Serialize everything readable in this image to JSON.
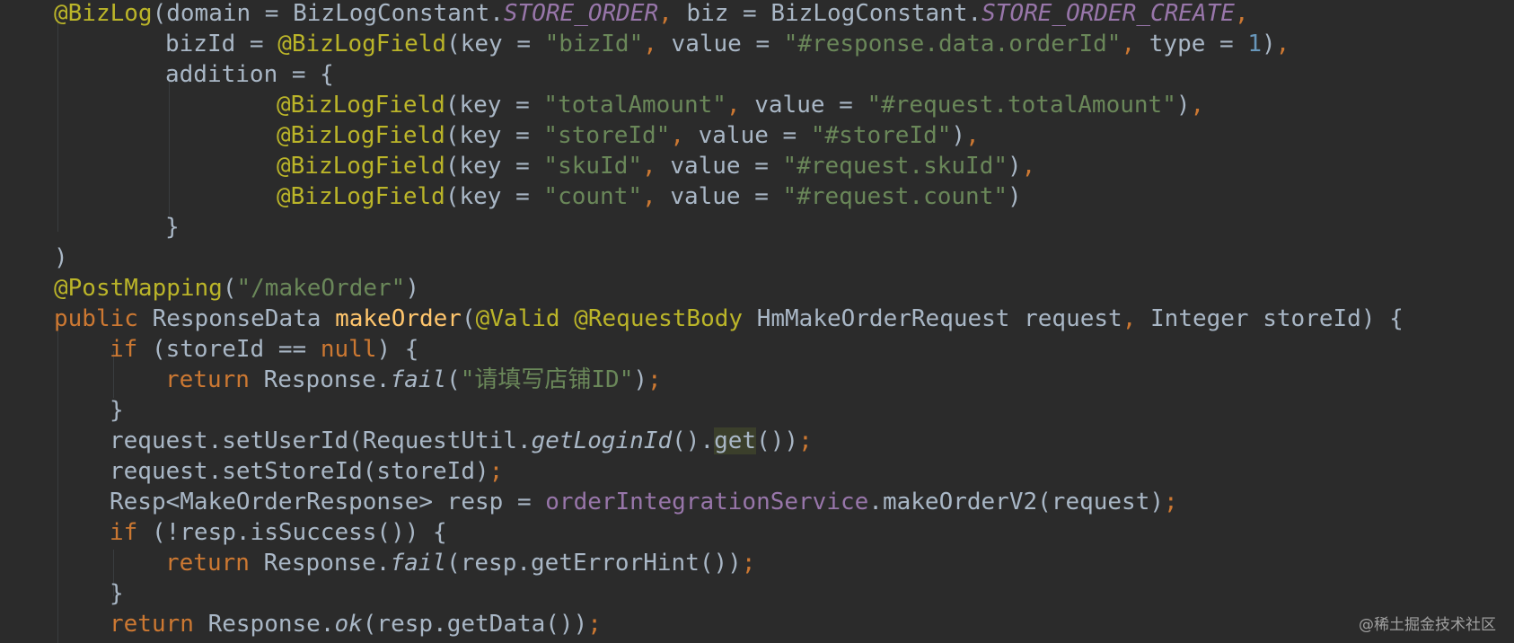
{
  "colors": {
    "background": "#2b2b2b",
    "default": "#a9b7c6",
    "keyword": "#cc7832",
    "annotation": "#bbb529",
    "string": "#6a8759",
    "number": "#6897bb",
    "static_field": "#9876aa",
    "method_decl": "#ffc66d",
    "instance_field": "#9876aa",
    "param_name": "#a9b7c6",
    "guide": "#3a3d3f",
    "watermark": "#c8c8c8"
  },
  "code_lines": [
    {
      "indent": 0,
      "tokens": [
        {
          "t": "@BizLog",
          "k": "annotation"
        },
        {
          "t": "(domain = BizLogConstant.",
          "k": "default"
        },
        {
          "t": "STORE_ORDER",
          "k": "static_field_italic"
        },
        {
          "t": ", ",
          "k": "keyword"
        },
        {
          "t": "biz = BizLogConstant.",
          "k": "default"
        },
        {
          "t": "STORE_ORDER_CREATE",
          "k": "static_field_italic"
        },
        {
          "t": ",",
          "k": "keyword"
        }
      ]
    },
    {
      "indent": 2,
      "tokens": [
        {
          "t": "bizId = ",
          "k": "default"
        },
        {
          "t": "@BizLogField",
          "k": "annotation"
        },
        {
          "t": "(key = ",
          "k": "default"
        },
        {
          "t": "\"bizId\"",
          "k": "string"
        },
        {
          "t": ", ",
          "k": "keyword"
        },
        {
          "t": "value = ",
          "k": "default"
        },
        {
          "t": "\"#response.data.orderId\"",
          "k": "string"
        },
        {
          "t": ", ",
          "k": "keyword"
        },
        {
          "t": "type = ",
          "k": "default"
        },
        {
          "t": "1",
          "k": "number"
        },
        {
          "t": ")",
          "k": "default"
        },
        {
          "t": ",",
          "k": "keyword"
        }
      ]
    },
    {
      "indent": 2,
      "tokens": [
        {
          "t": "addition = {",
          "k": "default"
        }
      ]
    },
    {
      "indent": 4,
      "tokens": [
        {
          "t": "@BizLogField",
          "k": "annotation"
        },
        {
          "t": "(key = ",
          "k": "default"
        },
        {
          "t": "\"totalAmount\"",
          "k": "string"
        },
        {
          "t": ", ",
          "k": "keyword"
        },
        {
          "t": "value = ",
          "k": "default"
        },
        {
          "t": "\"#request.totalAmount\"",
          "k": "string"
        },
        {
          "t": ")",
          "k": "default"
        },
        {
          "t": ",",
          "k": "keyword"
        }
      ]
    },
    {
      "indent": 4,
      "tokens": [
        {
          "t": "@BizLogField",
          "k": "annotation"
        },
        {
          "t": "(key = ",
          "k": "default"
        },
        {
          "t": "\"storeId\"",
          "k": "string"
        },
        {
          "t": ", ",
          "k": "keyword"
        },
        {
          "t": "value = ",
          "k": "default"
        },
        {
          "t": "\"#storeId\"",
          "k": "string"
        },
        {
          "t": ")",
          "k": "default"
        },
        {
          "t": ",",
          "k": "keyword"
        }
      ]
    },
    {
      "indent": 4,
      "tokens": [
        {
          "t": "@BizLogField",
          "k": "annotation"
        },
        {
          "t": "(key = ",
          "k": "default"
        },
        {
          "t": "\"skuId\"",
          "k": "string"
        },
        {
          "t": ", ",
          "k": "keyword"
        },
        {
          "t": "value = ",
          "k": "default"
        },
        {
          "t": "\"#request.skuId\"",
          "k": "string"
        },
        {
          "t": ")",
          "k": "default"
        },
        {
          "t": ",",
          "k": "keyword"
        }
      ]
    },
    {
      "indent": 4,
      "tokens": [
        {
          "t": "@BizLogField",
          "k": "annotation"
        },
        {
          "t": "(key = ",
          "k": "default"
        },
        {
          "t": "\"count\"",
          "k": "string"
        },
        {
          "t": ", ",
          "k": "keyword"
        },
        {
          "t": "value = ",
          "k": "default"
        },
        {
          "t": "\"#request.count\"",
          "k": "string"
        },
        {
          "t": ")",
          "k": "default"
        }
      ]
    },
    {
      "indent": 2,
      "tokens": [
        {
          "t": "}",
          "k": "default"
        }
      ]
    },
    {
      "indent": 0,
      "tokens": [
        {
          "t": ")",
          "k": "default"
        }
      ]
    },
    {
      "indent": 0,
      "tokens": [
        {
          "t": "@PostMapping",
          "k": "annotation"
        },
        {
          "t": "(",
          "k": "default"
        },
        {
          "t": "\"/makeOrder\"",
          "k": "string"
        },
        {
          "t": ")",
          "k": "default"
        }
      ]
    },
    {
      "indent": 0,
      "tokens": [
        {
          "t": "public ",
          "k": "keyword"
        },
        {
          "t": "ResponseData ",
          "k": "default"
        },
        {
          "t": "makeOrder",
          "k": "method_decl"
        },
        {
          "t": "(",
          "k": "default"
        },
        {
          "t": "@Valid ",
          "k": "annotation"
        },
        {
          "t": "@RequestBody ",
          "k": "annotation"
        },
        {
          "t": "HmMakeOrderRequest request",
          "k": "default"
        },
        {
          "t": ", ",
          "k": "keyword"
        },
        {
          "t": "Integer storeId) {",
          "k": "default"
        }
      ]
    },
    {
      "indent": 1,
      "tokens": [
        {
          "t": "if ",
          "k": "keyword"
        },
        {
          "t": "(storeId == ",
          "k": "default"
        },
        {
          "t": "null",
          "k": "keyword"
        },
        {
          "t": ") {",
          "k": "default"
        }
      ]
    },
    {
      "indent": 2,
      "tokens": [
        {
          "t": "return ",
          "k": "keyword"
        },
        {
          "t": "Response.",
          "k": "default"
        },
        {
          "t": "fail",
          "k": "italic"
        },
        {
          "t": "(",
          "k": "default"
        },
        {
          "t": "\"请填写店铺ID\"",
          "k": "string"
        },
        {
          "t": ")",
          "k": "default"
        },
        {
          "t": ";",
          "k": "keyword"
        }
      ]
    },
    {
      "indent": 1,
      "tokens": [
        {
          "t": "}",
          "k": "default"
        }
      ]
    },
    {
      "indent": 1,
      "tokens": [
        {
          "t": "request.setUserId(RequestUtil.",
          "k": "default"
        },
        {
          "t": "getLoginId",
          "k": "italic"
        },
        {
          "t": "().",
          "k": "default"
        },
        {
          "t": "get",
          "k": "selected"
        },
        {
          "t": "())",
          "k": "default"
        },
        {
          "t": ";",
          "k": "keyword"
        }
      ]
    },
    {
      "indent": 1,
      "tokens": [
        {
          "t": "request.setStoreId(storeId)",
          "k": "default"
        },
        {
          "t": ";",
          "k": "keyword"
        }
      ]
    },
    {
      "indent": 1,
      "tokens": [
        {
          "t": "Resp<MakeOrderResponse> resp = ",
          "k": "default"
        },
        {
          "t": "orderIntegrationService",
          "k": "instance_field"
        },
        {
          "t": ".makeOrderV2(request)",
          "k": "default"
        },
        {
          "t": ";",
          "k": "keyword"
        }
      ]
    },
    {
      "indent": 1,
      "tokens": [
        {
          "t": "if ",
          "k": "keyword"
        },
        {
          "t": "(!resp.isSuccess()) {",
          "k": "default"
        }
      ]
    },
    {
      "indent": 2,
      "tokens": [
        {
          "t": "return ",
          "k": "keyword"
        },
        {
          "t": "Response.",
          "k": "default"
        },
        {
          "t": "fail",
          "k": "italic"
        },
        {
          "t": "(resp.getErrorHint())",
          "k": "default"
        },
        {
          "t": ";",
          "k": "keyword"
        }
      ]
    },
    {
      "indent": 1,
      "tokens": [
        {
          "t": "}",
          "k": "default"
        }
      ]
    },
    {
      "indent": 1,
      "tokens": [
        {
          "t": "return ",
          "k": "keyword"
        },
        {
          "t": "Response.",
          "k": "default"
        },
        {
          "t": "ok",
          "k": "italic"
        },
        {
          "t": "(resp.getData())",
          "k": "default"
        },
        {
          "t": ";",
          "k": "keyword"
        }
      ]
    }
  ],
  "watermark": "@稀土掘金技术社区"
}
